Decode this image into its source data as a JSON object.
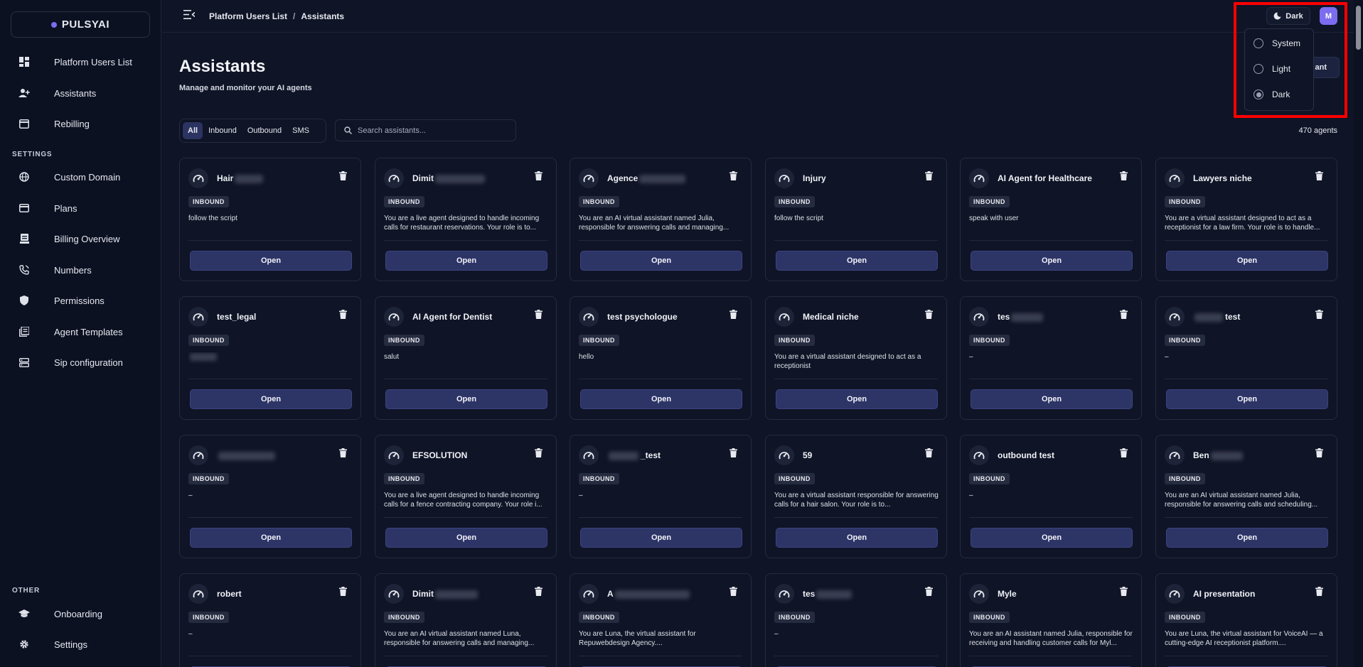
{
  "brand": {
    "name": "PULSYAI"
  },
  "sidebar": {
    "items": [
      {
        "label": "Platform Users List",
        "icon": "dashboard-icon"
      },
      {
        "label": "Assistants",
        "icon": "user-plus-icon"
      },
      {
        "label": "Rebilling",
        "icon": "receipt-icon"
      }
    ],
    "settings_label": "SETTINGS",
    "settings_items": [
      {
        "label": "Custom Domain",
        "icon": "globe-icon"
      },
      {
        "label": "Plans",
        "icon": "credit-card-icon"
      },
      {
        "label": "Billing Overview",
        "icon": "billing-icon"
      },
      {
        "label": "Numbers",
        "icon": "phone-icon"
      },
      {
        "label": "Permissions",
        "icon": "shield-icon"
      },
      {
        "label": "Agent Templates",
        "icon": "templates-icon"
      },
      {
        "label": "Sip configuration",
        "icon": "server-icon"
      }
    ],
    "other_label": "OTHER",
    "other_items": [
      {
        "label": "Onboarding",
        "icon": "graduation-cap-icon"
      },
      {
        "label": "Settings",
        "icon": "gear-icon"
      }
    ]
  },
  "topbar": {
    "breadcrumb": [
      "Platform Users List",
      "Assistants"
    ],
    "breadcrumb_sep": "/",
    "theme_label": "Dark",
    "avatar_initial": "M"
  },
  "main": {
    "title": "Assistants",
    "subtitle": "Manage and monitor your AI agents",
    "new_button_partial": "ant",
    "filters": [
      "All",
      "Inbound",
      "Outbound",
      "SMS"
    ],
    "active_filter": "All",
    "search_placeholder": "Search assistants...",
    "agent_count": "470 agents",
    "open_label": "Open",
    "cards": [
      {
        "name": "Hair",
        "blur": 40,
        "type": "INBOUND",
        "desc": "follow the script"
      },
      {
        "name": "Dimit",
        "blur": 70,
        "type": "INBOUND",
        "desc": "You are a live agent designed to handle incoming calls for restaurant reservations. Your role is to..."
      },
      {
        "name": "Agence",
        "blur": 65,
        "type": "INBOUND",
        "desc": "You are an AI virtual assistant named Julia, responsible for answering calls and managing..."
      },
      {
        "name": "Injury",
        "blur": 0,
        "type": "INBOUND",
        "desc": "follow the script"
      },
      {
        "name": "AI Agent for Healthcare",
        "blur": 0,
        "type": "INBOUND",
        "desc": "speak with user"
      },
      {
        "name": "Lawyers niche",
        "blur": 0,
        "type": "INBOUND",
        "desc": "You are a virtual assistant designed to act as a receptionist for a law firm. Your role is to handle..."
      },
      {
        "name": "test_legal",
        "blur": 0,
        "type": "INBOUND",
        "desc": "",
        "desc_blur": true
      },
      {
        "name": "AI Agent for Dentist",
        "blur": 0,
        "type": "INBOUND",
        "desc": "salut"
      },
      {
        "name": "test psychologue",
        "blur": 0,
        "type": "INBOUND",
        "desc": "hello"
      },
      {
        "name": "Medical niche",
        "blur": 0,
        "type": "INBOUND",
        "desc": "You are a virtual assistant designed to act as a receptionist"
      },
      {
        "name": "tes",
        "blur": 45,
        "type": "INBOUND",
        "desc": "–"
      },
      {
        "name": "test",
        "blur_before": 40,
        "blur": 0,
        "type": "INBOUND",
        "desc": "–"
      },
      {
        "name": "",
        "blur_before": 80,
        "blur": 0,
        "type": "INBOUND",
        "desc": "–"
      },
      {
        "name": "EFSOLUTION",
        "blur": 0,
        "type": "INBOUND",
        "desc": "You are a live agent designed to handle incoming calls for a fence contracting company. Your role i..."
      },
      {
        "name": "_test",
        "blur_before": 42,
        "blur": 0,
        "type": "INBOUND",
        "desc": "–"
      },
      {
        "name": "59",
        "blur": 0,
        "type": "INBOUND",
        "desc": "You are a virtual assistant responsible for answering calls for a hair salon. Your role is to..."
      },
      {
        "name": "outbound test",
        "blur": 0,
        "type": "INBOUND",
        "desc": "–"
      },
      {
        "name": "Ben",
        "blur": 45,
        "type": "INBOUND",
        "desc": "You are an AI virtual assistant named Julia, responsible for answering calls and scheduling..."
      },
      {
        "name": "robert",
        "blur": 0,
        "type": "INBOUND",
        "desc": "–"
      },
      {
        "name": "Dimit",
        "blur": 60,
        "type": "INBOUND",
        "desc": "You are an AI virtual assistant named Luna, responsible for answering calls and managing..."
      },
      {
        "name": "A",
        "blur": 105,
        "type": "INBOUND",
        "desc": "You are Luna, the virtual assistant for Repuwebdesign Agency...."
      },
      {
        "name": "tes",
        "blur": 50,
        "type": "INBOUND",
        "desc": "–"
      },
      {
        "name": "Myle",
        "blur": 0,
        "type": "INBOUND",
        "desc": "You are an AI assistant named Julia, responsible for receiving and handling customer calls for Myl..."
      },
      {
        "name": "AI presentation",
        "blur": 0,
        "type": "INBOUND",
        "desc": "You are Luna, the virtual assistant for VoiceAI — a cutting-edge AI receptionist platform...."
      }
    ]
  },
  "theme_menu": {
    "options": [
      "System",
      "Light",
      "Dark"
    ],
    "selected": "Dark"
  },
  "colors": {
    "background": "#0f1426",
    "sidebar": "#0c1122",
    "accent": "#7b6cf0",
    "open_button": "#2d3466",
    "highlight": "#ff0000"
  }
}
